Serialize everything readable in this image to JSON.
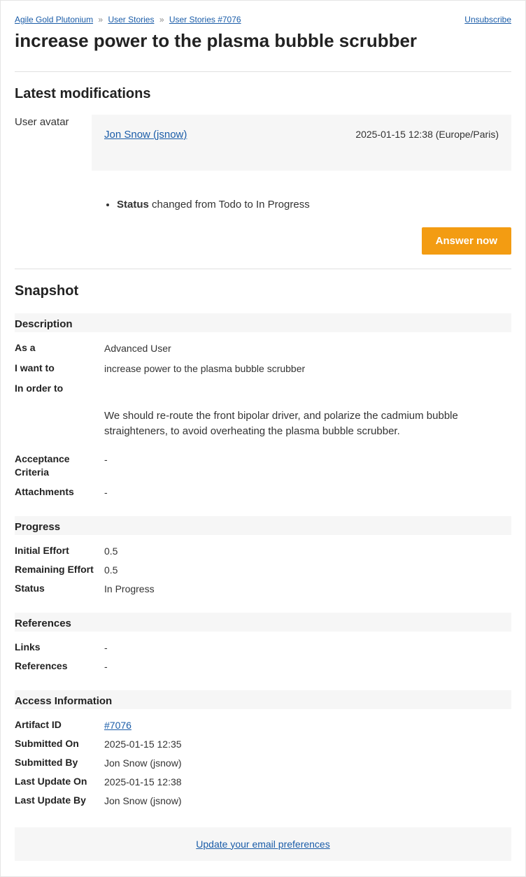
{
  "breadcrumb": {
    "project": "Agile Gold Plutonium",
    "tracker": "User Stories",
    "item": "User Stories #7076"
  },
  "unsubscribe": "Unsubscribe",
  "title": "increase power to the plasma bubble scrubber",
  "latest_modifications": {
    "heading": "Latest modifications",
    "avatar_label": "User avatar",
    "author": "Jon Snow (jsnow)",
    "timestamp": "2025-01-15 12:38 (Europe/Paris)",
    "change_field": "Status",
    "change_text": " changed from Todo to In Progress",
    "answer_btn": "Answer now"
  },
  "snapshot": {
    "heading": "Snapshot",
    "description": {
      "header": "Description",
      "as_a_label": "As a",
      "as_a_value": "Advanced User",
      "i_want_to_label": "I want to",
      "i_want_to_value": "increase power to the plasma bubble scrubber",
      "in_order_to_label": "In order to",
      "in_order_to_value": "",
      "body": "We should re-route the front bipolar driver, and polarize the cadmium bubble straighteners, to avoid overheating the plasma bubble scrubber.",
      "acceptance_label": "Acceptance Criteria",
      "acceptance_value": "-",
      "attachments_label": "Attachments",
      "attachments_value": "-"
    },
    "progress": {
      "header": "Progress",
      "initial_effort_label": "Initial Effort",
      "initial_effort_value": "0.5",
      "remaining_effort_label": "Remaining Effort",
      "remaining_effort_value": "0.5",
      "status_label": "Status",
      "status_value": "In Progress"
    },
    "references": {
      "header": "References",
      "links_label": "Links",
      "links_value": "-",
      "references_label": "References",
      "references_value": "-"
    },
    "access": {
      "header": "Access Information",
      "artifact_id_label": "Artifact ID",
      "artifact_id_value": "#7076",
      "submitted_on_label": "Submitted On",
      "submitted_on_value": "2025-01-15 12:35",
      "submitted_by_label": "Submitted By",
      "submitted_by_value": "Jon Snow (jsnow)",
      "last_update_on_label": "Last Update On",
      "last_update_on_value": "2025-01-15 12:38",
      "last_update_by_label": "Last Update By",
      "last_update_by_value": "Jon Snow (jsnow)"
    }
  },
  "footer": {
    "preferences": "Update your email preferences"
  }
}
